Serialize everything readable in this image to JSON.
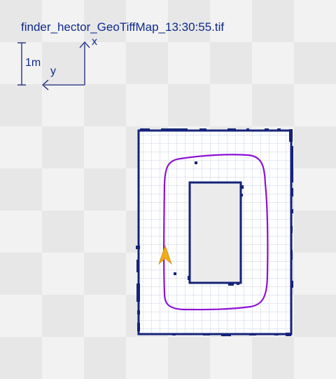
{
  "map": {
    "title": "finder_hector_GeoTiffMap_13:30:55.tif",
    "scale_label": "1m",
    "x_axis_label": "x",
    "y_axis_label": "y"
  },
  "colors": {
    "wall": "#14237a",
    "grid": "#c9d2e3",
    "free_space": "#ffffff",
    "unknown_space": "#ebebeb",
    "robot_path": "#8d11d6",
    "robot_marker": "#f2ab19",
    "text": "#0e2a8c"
  },
  "icons": {
    "robot_pose": "robot-arrow-icon",
    "axes": "axes-legend-icon"
  }
}
